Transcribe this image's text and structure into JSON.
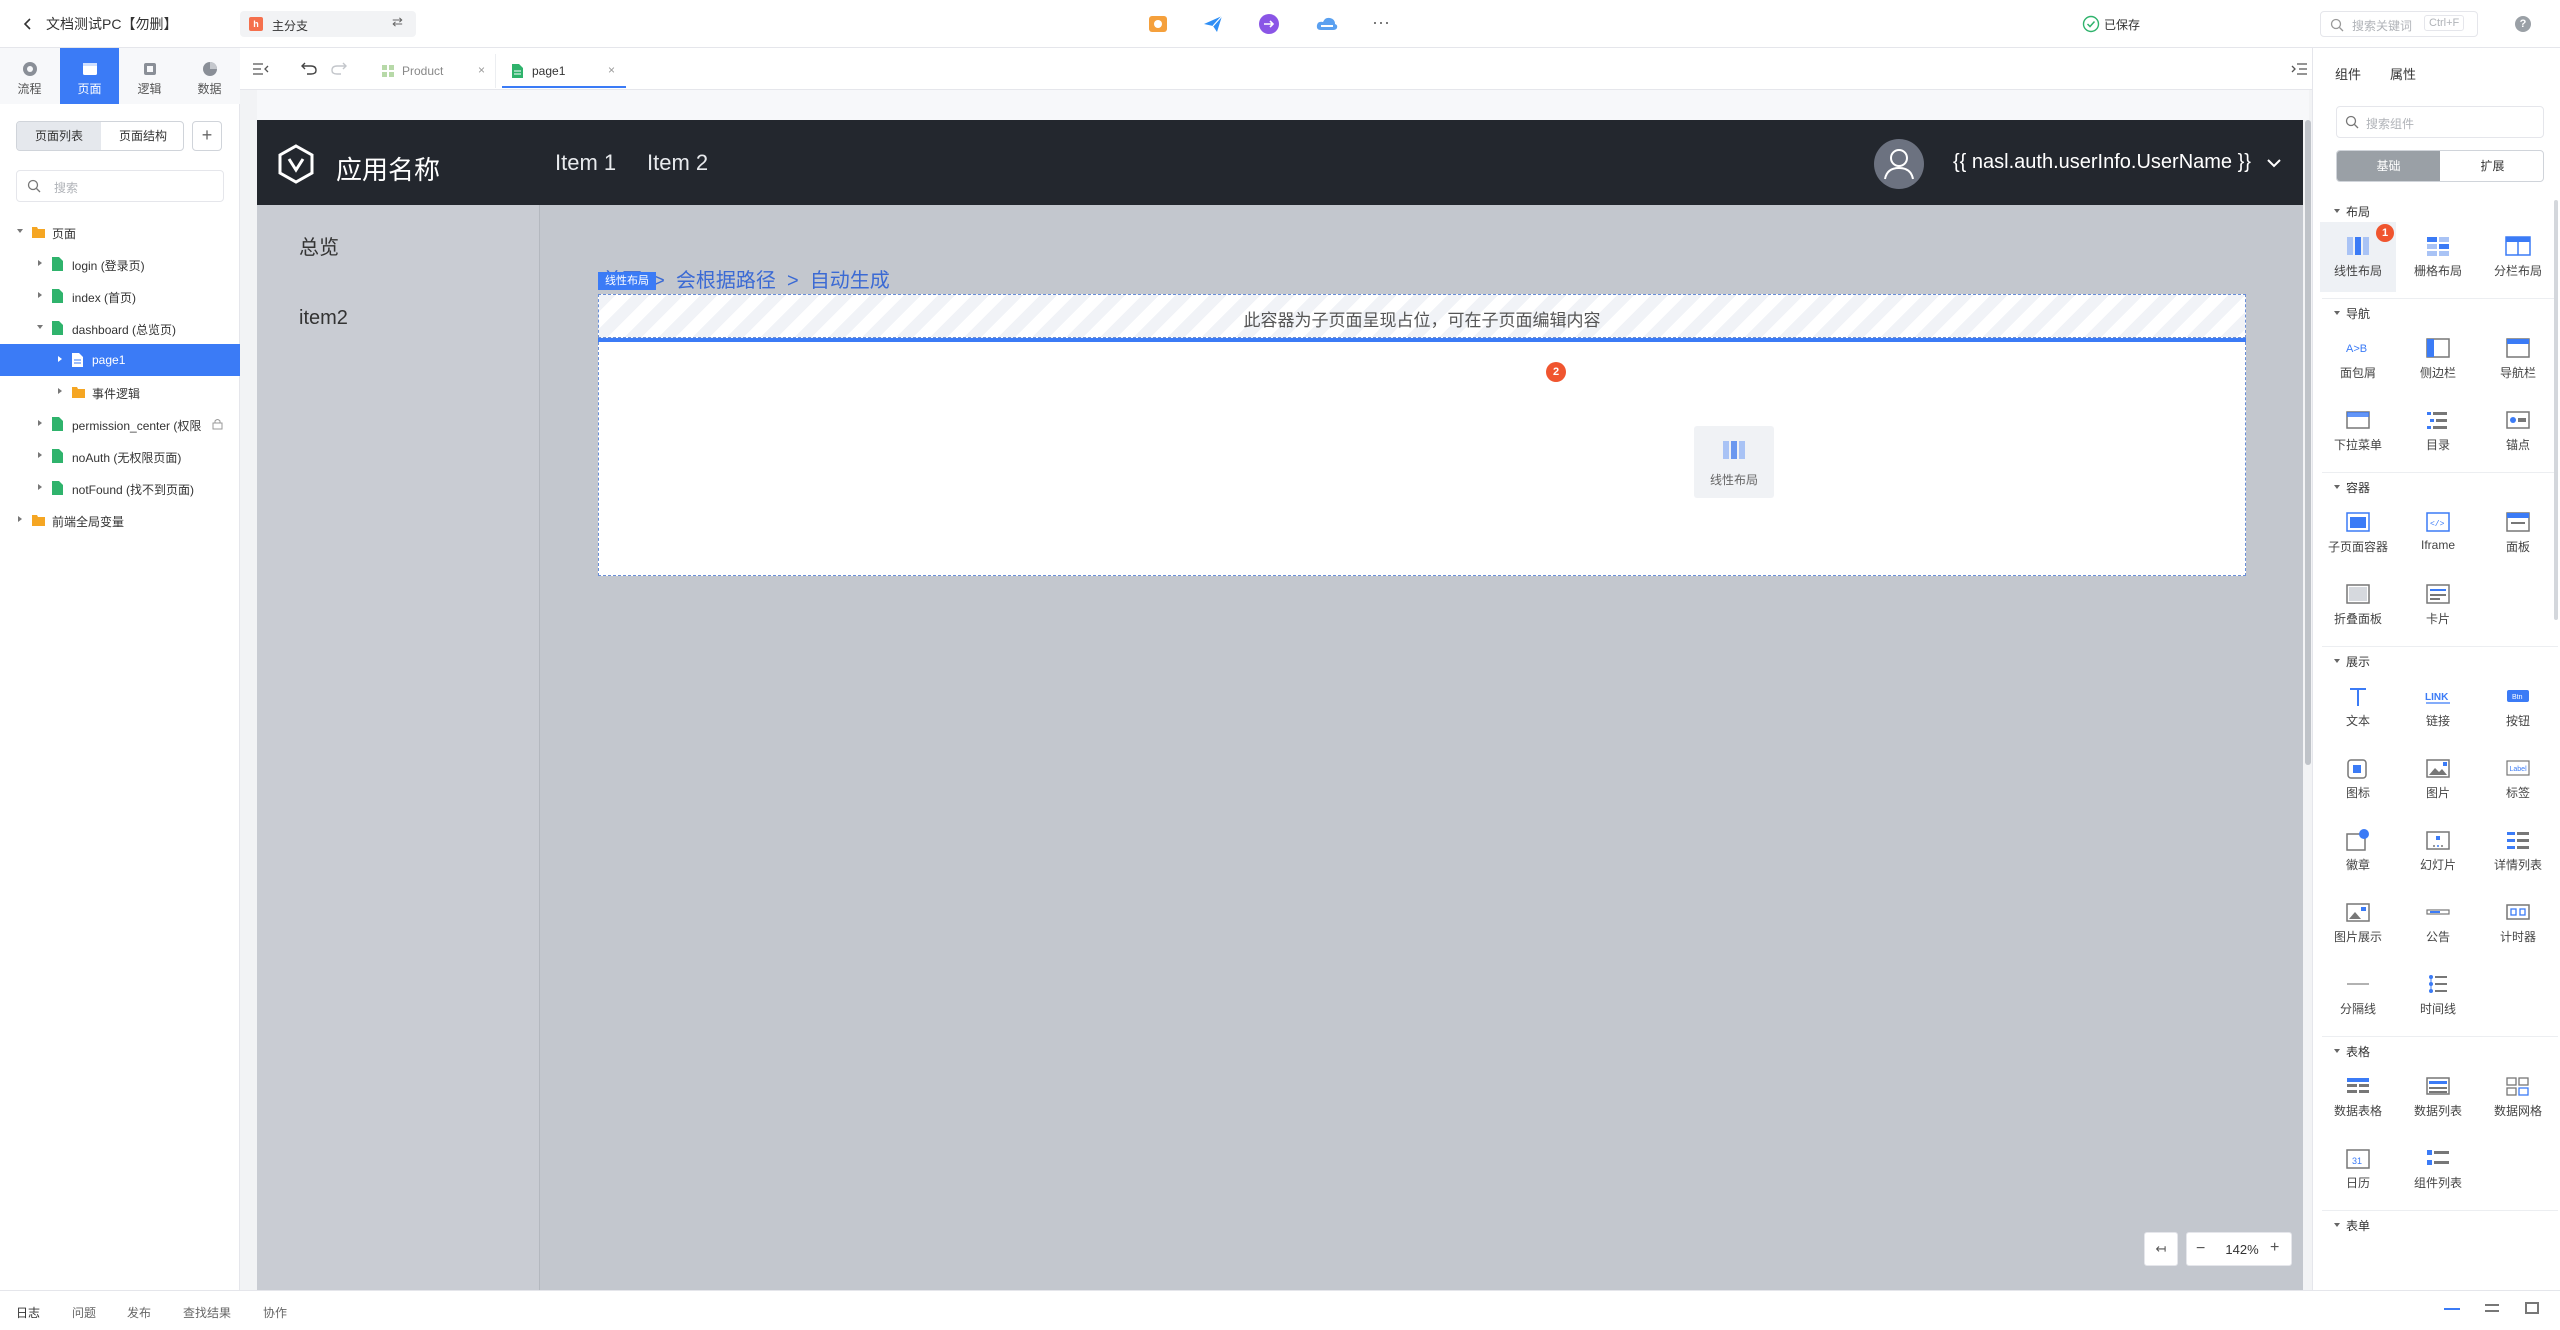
{
  "topbar": {
    "app_title": "文档测试PC【勿删】",
    "branch": "主分支",
    "branch_icon_text": "h",
    "saved": "已保存",
    "search_placeholder": "搜索关键词",
    "search_shortcut": "Ctrl+F",
    "help": "?",
    "more": "···",
    "tool_colors": [
      "#f5a03c",
      "#2e8ef5",
      "#8a55e6",
      "#5aa0f0"
    ]
  },
  "rail": {
    "items": [
      {
        "label": "流程",
        "icon": "flow-icon",
        "active": false
      },
      {
        "label": "页面",
        "icon": "page-icon",
        "active": true
      },
      {
        "label": "逻辑",
        "icon": "logic-icon",
        "active": false
      },
      {
        "label": "数据",
        "icon": "data-icon",
        "active": false
      }
    ]
  },
  "leftpanel": {
    "seg": [
      "页面列表",
      "页面结构"
    ],
    "add": "+",
    "search_placeholder": "搜索",
    "tree": [
      {
        "label": "页面",
        "indent": 0,
        "type": "folder",
        "expanded": true,
        "selected": false
      },
      {
        "label": "login (登录页)",
        "indent": 1,
        "type": "page",
        "expanded": false,
        "selected": false
      },
      {
        "label": "index (首页)",
        "indent": 1,
        "type": "page",
        "expanded": false,
        "selected": false
      },
      {
        "label": "dashboard (总览页)",
        "indent": 1,
        "type": "page",
        "expanded": true,
        "selected": false
      },
      {
        "label": "page1",
        "indent": 2,
        "type": "doc",
        "expanded": false,
        "selected": true
      },
      {
        "label": "事件逻辑",
        "indent": 2,
        "type": "folder",
        "expanded": false,
        "selected": false
      },
      {
        "label": "permission_center (权限",
        "indent": 1,
        "type": "page",
        "expanded": false,
        "selected": false
      },
      {
        "label": "noAuth (无权限页面)",
        "indent": 1,
        "type": "page",
        "expanded": false,
        "selected": false
      },
      {
        "label": "notFound (找不到页面)",
        "indent": 1,
        "type": "page",
        "expanded": false,
        "selected": false
      },
      {
        "label": "前端全局变量",
        "indent": 0,
        "type": "folder",
        "expanded": false,
        "selected": false
      }
    ]
  },
  "tabs": [
    {
      "label": "Product",
      "active": false
    },
    {
      "label": "page1",
      "active": true
    }
  ],
  "canvas": {
    "app_name": "应用名称",
    "nav_items": [
      "Item 1",
      "Item 2"
    ],
    "username": "{{ nasl.auth.userInfo.UserName }}",
    "sidebar": [
      "总览",
      "item2"
    ],
    "breadcrumb": "首页  >  会根据路径  >  自动生成",
    "layout_badge": "线性布局",
    "subpage_text": "此容器为子页面呈现占位，可在子页面编辑内容",
    "ghost_label": "线性布局",
    "badge_2": "2",
    "zoom": "142%",
    "zoom_minus": "−",
    "zoom_plus": "+",
    "zoom_fit": "↤"
  },
  "rightpanel": {
    "tabs": [
      "组件",
      "属性"
    ],
    "search_placeholder": "搜索组件",
    "seg": [
      "基础",
      "扩展"
    ],
    "badge_1": "1",
    "sections": [
      {
        "title": "布局",
        "items": [
          {
            "label": "线性布局",
            "icon": "linear-layout-icon"
          },
          {
            "label": "栅格布局",
            "icon": "grid-layout-icon"
          },
          {
            "label": "分栏布局",
            "icon": "columns-layout-icon"
          }
        ]
      },
      {
        "title": "导航",
        "items": [
          {
            "label": "面包屑",
            "icon": "breadcrumb-icon"
          },
          {
            "label": "侧边栏",
            "icon": "sidebar-icon"
          },
          {
            "label": "导航栏",
            "icon": "navbar-icon"
          },
          {
            "label": "下拉菜单",
            "icon": "dropdown-icon"
          },
          {
            "label": "目录",
            "icon": "toc-icon"
          },
          {
            "label": "锚点",
            "icon": "anchor-icon"
          }
        ]
      },
      {
        "title": "容器",
        "items": [
          {
            "label": "子页面容器",
            "icon": "subpage-container-icon"
          },
          {
            "label": "Iframe",
            "icon": "iframe-icon"
          },
          {
            "label": "面板",
            "icon": "panel-icon"
          },
          {
            "label": "折叠面板",
            "icon": "collapse-icon"
          },
          {
            "label": "卡片",
            "icon": "card-icon"
          }
        ]
      },
      {
        "title": "展示",
        "items": [
          {
            "label": "文本",
            "icon": "text-icon"
          },
          {
            "label": "链接",
            "icon": "link-icon"
          },
          {
            "label": "按钮",
            "icon": "button-icon"
          },
          {
            "label": "图标",
            "icon": "icon-icon"
          },
          {
            "label": "图片",
            "icon": "image-icon"
          },
          {
            "label": "标签",
            "icon": "label-icon"
          },
          {
            "label": "徽章",
            "icon": "badge-icon"
          },
          {
            "label": "幻灯片",
            "icon": "carousel-icon"
          },
          {
            "label": "详情列表",
            "icon": "detail-list-icon"
          },
          {
            "label": "图片展示",
            "icon": "gallery-icon"
          },
          {
            "label": "公告",
            "icon": "notice-icon"
          },
          {
            "label": "计时器",
            "icon": "timer-icon"
          },
          {
            "label": "分隔线",
            "icon": "divider-icon"
          },
          {
            "label": "时间线",
            "icon": "timeline-icon"
          }
        ]
      },
      {
        "title": "表格",
        "items": [
          {
            "label": "数据表格",
            "icon": "data-table-icon"
          },
          {
            "label": "数据列表",
            "icon": "data-list-icon"
          },
          {
            "label": "数据网格",
            "icon": "data-grid-icon"
          },
          {
            "label": "日历",
            "icon": "calendar-icon"
          },
          {
            "label": "组件列表",
            "icon": "component-list-icon"
          }
        ]
      },
      {
        "title": "表单",
        "items": []
      }
    ]
  },
  "bottombar": {
    "tabs": [
      "日志",
      "问题",
      "发布",
      "查找结果",
      "协作"
    ]
  },
  "colors": {
    "accent": "#3b7bf6",
    "app_header": "#23272e",
    "canvas": "#c3c7ce",
    "badge": "#f0552f"
  }
}
